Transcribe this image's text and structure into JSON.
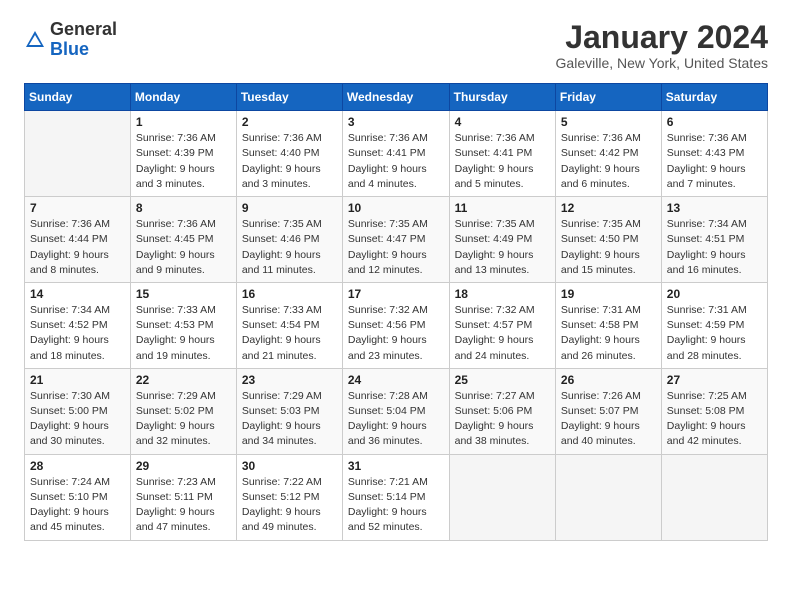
{
  "header": {
    "logo_general": "General",
    "logo_blue": "Blue",
    "title": "January 2024",
    "subtitle": "Galeville, New York, United States"
  },
  "weekdays": [
    "Sunday",
    "Monday",
    "Tuesday",
    "Wednesday",
    "Thursday",
    "Friday",
    "Saturday"
  ],
  "weeks": [
    [
      {
        "day": "",
        "sunrise": "",
        "sunset": "",
        "daylight": ""
      },
      {
        "day": "1",
        "sunrise": "7:36 AM",
        "sunset": "4:39 PM",
        "daylight": "9 hours and 3 minutes."
      },
      {
        "day": "2",
        "sunrise": "7:36 AM",
        "sunset": "4:40 PM",
        "daylight": "9 hours and 3 minutes."
      },
      {
        "day": "3",
        "sunrise": "7:36 AM",
        "sunset": "4:41 PM",
        "daylight": "9 hours and 4 minutes."
      },
      {
        "day": "4",
        "sunrise": "7:36 AM",
        "sunset": "4:41 PM",
        "daylight": "9 hours and 5 minutes."
      },
      {
        "day": "5",
        "sunrise": "7:36 AM",
        "sunset": "4:42 PM",
        "daylight": "9 hours and 6 minutes."
      },
      {
        "day": "6",
        "sunrise": "7:36 AM",
        "sunset": "4:43 PM",
        "daylight": "9 hours and 7 minutes."
      }
    ],
    [
      {
        "day": "7",
        "sunrise": "7:36 AM",
        "sunset": "4:44 PM",
        "daylight": "9 hours and 8 minutes."
      },
      {
        "day": "8",
        "sunrise": "7:36 AM",
        "sunset": "4:45 PM",
        "daylight": "9 hours and 9 minutes."
      },
      {
        "day": "9",
        "sunrise": "7:35 AM",
        "sunset": "4:46 PM",
        "daylight": "9 hours and 11 minutes."
      },
      {
        "day": "10",
        "sunrise": "7:35 AM",
        "sunset": "4:47 PM",
        "daylight": "9 hours and 12 minutes."
      },
      {
        "day": "11",
        "sunrise": "7:35 AM",
        "sunset": "4:49 PM",
        "daylight": "9 hours and 13 minutes."
      },
      {
        "day": "12",
        "sunrise": "7:35 AM",
        "sunset": "4:50 PM",
        "daylight": "9 hours and 15 minutes."
      },
      {
        "day": "13",
        "sunrise": "7:34 AM",
        "sunset": "4:51 PM",
        "daylight": "9 hours and 16 minutes."
      }
    ],
    [
      {
        "day": "14",
        "sunrise": "7:34 AM",
        "sunset": "4:52 PM",
        "daylight": "9 hours and 18 minutes."
      },
      {
        "day": "15",
        "sunrise": "7:33 AM",
        "sunset": "4:53 PM",
        "daylight": "9 hours and 19 minutes."
      },
      {
        "day": "16",
        "sunrise": "7:33 AM",
        "sunset": "4:54 PM",
        "daylight": "9 hours and 21 minutes."
      },
      {
        "day": "17",
        "sunrise": "7:32 AM",
        "sunset": "4:56 PM",
        "daylight": "9 hours and 23 minutes."
      },
      {
        "day": "18",
        "sunrise": "7:32 AM",
        "sunset": "4:57 PM",
        "daylight": "9 hours and 24 minutes."
      },
      {
        "day": "19",
        "sunrise": "7:31 AM",
        "sunset": "4:58 PM",
        "daylight": "9 hours and 26 minutes."
      },
      {
        "day": "20",
        "sunrise": "7:31 AM",
        "sunset": "4:59 PM",
        "daylight": "9 hours and 28 minutes."
      }
    ],
    [
      {
        "day": "21",
        "sunrise": "7:30 AM",
        "sunset": "5:00 PM",
        "daylight": "9 hours and 30 minutes."
      },
      {
        "day": "22",
        "sunrise": "7:29 AM",
        "sunset": "5:02 PM",
        "daylight": "9 hours and 32 minutes."
      },
      {
        "day": "23",
        "sunrise": "7:29 AM",
        "sunset": "5:03 PM",
        "daylight": "9 hours and 34 minutes."
      },
      {
        "day": "24",
        "sunrise": "7:28 AM",
        "sunset": "5:04 PM",
        "daylight": "9 hours and 36 minutes."
      },
      {
        "day": "25",
        "sunrise": "7:27 AM",
        "sunset": "5:06 PM",
        "daylight": "9 hours and 38 minutes."
      },
      {
        "day": "26",
        "sunrise": "7:26 AM",
        "sunset": "5:07 PM",
        "daylight": "9 hours and 40 minutes."
      },
      {
        "day": "27",
        "sunrise": "7:25 AM",
        "sunset": "5:08 PM",
        "daylight": "9 hours and 42 minutes."
      }
    ],
    [
      {
        "day": "28",
        "sunrise": "7:24 AM",
        "sunset": "5:10 PM",
        "daylight": "9 hours and 45 minutes."
      },
      {
        "day": "29",
        "sunrise": "7:23 AM",
        "sunset": "5:11 PM",
        "daylight": "9 hours and 47 minutes."
      },
      {
        "day": "30",
        "sunrise": "7:22 AM",
        "sunset": "5:12 PM",
        "daylight": "9 hours and 49 minutes."
      },
      {
        "day": "31",
        "sunrise": "7:21 AM",
        "sunset": "5:14 PM",
        "daylight": "9 hours and 52 minutes."
      },
      {
        "day": "",
        "sunrise": "",
        "sunset": "",
        "daylight": ""
      },
      {
        "day": "",
        "sunrise": "",
        "sunset": "",
        "daylight": ""
      },
      {
        "day": "",
        "sunrise": "",
        "sunset": "",
        "daylight": ""
      }
    ]
  ],
  "labels": {
    "sunrise_prefix": "Sunrise: ",
    "sunset_prefix": "Sunset: ",
    "daylight_prefix": "Daylight: "
  }
}
